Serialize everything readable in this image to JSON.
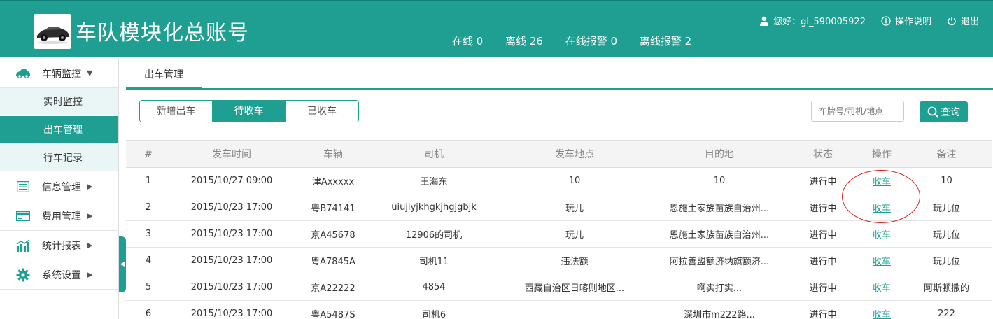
{
  "header": {
    "title": "车队模块化总账号",
    "stats": [
      "在线 0",
      "离线 26",
      "在线报警 0",
      "离线报警 2"
    ],
    "greeting": "您好：gl_590005922",
    "help": "操作说明",
    "logout": "退出"
  },
  "sidebar": {
    "groups": [
      {
        "label": "车辆监控",
        "icon": "car-icon",
        "expanded": true
      },
      {
        "label": "信息管理",
        "icon": "list-icon"
      },
      {
        "label": "费用管理",
        "icon": "card-icon"
      },
      {
        "label": "统计报表",
        "icon": "bar-chart-icon"
      },
      {
        "label": "系统设置",
        "icon": "gear-icon"
      }
    ],
    "sub_items": [
      "实时监控",
      "出车管理",
      "行车记录"
    ],
    "active_sub": "出车管理"
  },
  "main": {
    "tab": "出车管理",
    "segments": [
      "新增出车",
      "待收车",
      "已收车"
    ],
    "active_segment": "待收车",
    "search_placeholder": "车牌号/司机/地点",
    "search_button": "查询"
  },
  "table": {
    "columns": [
      "#",
      "发车时间",
      "车辆",
      "司机",
      "发车地点",
      "目的地",
      "状态",
      "操作",
      "备注"
    ],
    "rows": [
      [
        "1",
        "2015/10/27 09:00",
        "津Axxxxx",
        "王海东",
        "10",
        "10",
        "进行中",
        "收车",
        "10"
      ],
      [
        "2",
        "2015/10/23 17:00",
        "粤B74141",
        "uiujiyjkhgkjhgjgbjk",
        "玩儿",
        "恩施土家族苗族自治州...",
        "进行中",
        "收车",
        "玩儿位"
      ],
      [
        "3",
        "2015/10/23 17:00",
        "京A45678",
        "12906的司机",
        "玩儿",
        "恩施土家族苗族自治州...",
        "进行中",
        "收车",
        "玩儿位"
      ],
      [
        "4",
        "2015/10/23 17:00",
        "粤A7845A",
        "司机11",
        "违法额",
        "阿拉善盟额济纳旗额济...",
        "进行中",
        "收车",
        "玩儿位"
      ],
      [
        "5",
        "2015/10/23 17:00",
        "京A22222",
        "4854",
        "西藏自治区日喀则地区...",
        "啊实打实...",
        "进行中",
        "收车",
        "阿斯顿撒的"
      ],
      [
        "6",
        "2015/10/23 17:00",
        "粤A5487S",
        "司机6",
        "",
        "深圳市m222路...",
        "进行中",
        "收车",
        "222"
      ]
    ]
  },
  "colors": {
    "accent": "#1f9f92",
    "highlight_circle": "#d82020"
  }
}
